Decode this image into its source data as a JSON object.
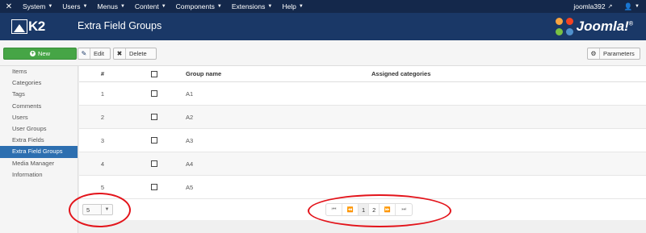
{
  "topbar": {
    "menus": [
      {
        "label": "System"
      },
      {
        "label": "Users"
      },
      {
        "label": "Menus"
      },
      {
        "label": "Content"
      },
      {
        "label": "Components"
      },
      {
        "label": "Extensions"
      },
      {
        "label": "Help"
      }
    ],
    "site_link": "joomla392",
    "icons": {
      "brand": "joomla-icon",
      "external": "external-link-icon",
      "user": "user-icon",
      "caret": "caret-down-icon"
    }
  },
  "header": {
    "k2_logo_text": "K2",
    "title": "Extra Field Groups",
    "joomla_logo_text": "Joomla!",
    "joomla_logo_reg": "®"
  },
  "toolbar": {
    "new_label": "New",
    "edit_label": "Edit",
    "delete_label": "Delete",
    "parameters_label": "Parameters",
    "new_color": "#46a546"
  },
  "sidebar": {
    "items": [
      {
        "label": "Items"
      },
      {
        "label": "Categories"
      },
      {
        "label": "Tags"
      },
      {
        "label": "Comments"
      },
      {
        "label": "Users"
      },
      {
        "label": "User Groups"
      },
      {
        "label": "Extra Fields"
      },
      {
        "label": "Extra Field Groups",
        "active": true
      },
      {
        "label": "Media Manager"
      },
      {
        "label": "Information"
      }
    ],
    "active_color": "#2d6fb0"
  },
  "table": {
    "headers": {
      "num": "#",
      "name": "Group name",
      "categories": "Assigned categories"
    },
    "rows": [
      {
        "num": "1",
        "name": "A1",
        "categories": ""
      },
      {
        "num": "2",
        "name": "A2",
        "categories": ""
      },
      {
        "num": "3",
        "name": "A3",
        "categories": ""
      },
      {
        "num": "4",
        "name": "A4",
        "categories": ""
      },
      {
        "num": "5",
        "name": "A5",
        "categories": ""
      }
    ]
  },
  "pagination": {
    "limit_value": "5",
    "pages": [
      "1",
      "2"
    ],
    "current_page": "1",
    "icons": {
      "first": "first-page-icon",
      "prev": "prev-page-icon",
      "next": "next-page-icon",
      "last": "last-page-icon"
    }
  },
  "annotations": {
    "ring_color": "#e3141b"
  }
}
